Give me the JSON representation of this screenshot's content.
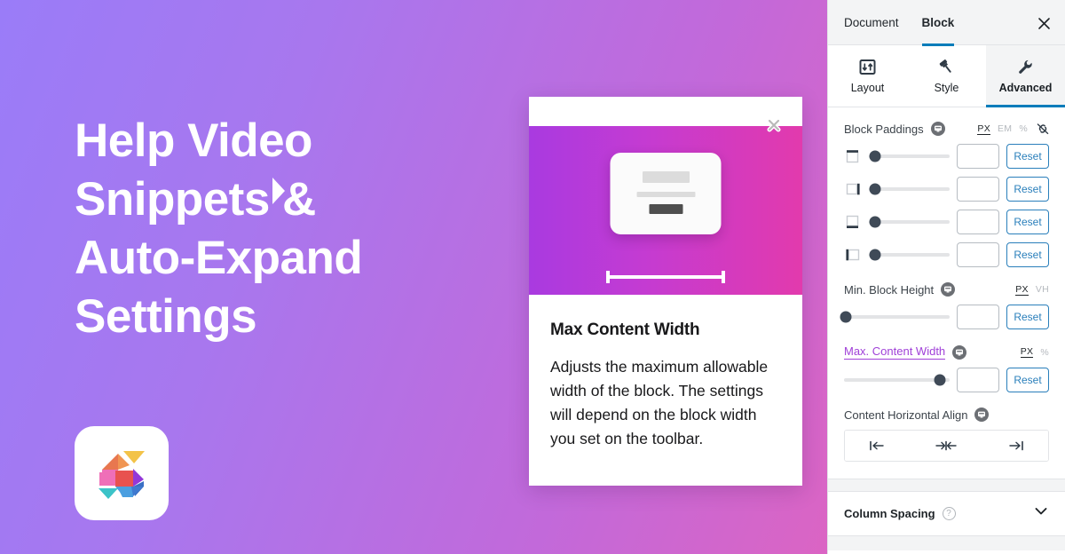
{
  "promo": {
    "title": "Help Video\nSnippets &\nAuto-Expand\nSettings",
    "logo_name": "stackable-logo"
  },
  "help_card": {
    "close_label": "✕",
    "title": "Max Content Width",
    "description": "Adjusts the maximum allowable width of the block. The settings will depend on the block width you set on the toolbar."
  },
  "inspector": {
    "tabs": [
      {
        "label": "Document",
        "active": false
      },
      {
        "label": "Block",
        "active": true
      }
    ],
    "close_label": "✕",
    "sections": [
      {
        "label": "Layout",
        "icon": "layout-icon",
        "active": false
      },
      {
        "label": "Style",
        "icon": "brush-icon",
        "active": false
      },
      {
        "label": "Advanced",
        "icon": "wrench-icon",
        "active": true
      }
    ],
    "block_paddings": {
      "label": "Block Paddings",
      "help_icon": "help-video-icon",
      "units": [
        {
          "label": "PX",
          "active": true
        },
        {
          "label": "EM",
          "active": false
        },
        {
          "label": "%",
          "active": false
        }
      ],
      "link_icon": "unlink-icon",
      "rows": [
        {
          "side": "top",
          "icon": "padding-top-icon",
          "value": "",
          "knob_pct": 8,
          "reset_label": "Reset"
        },
        {
          "side": "right",
          "icon": "padding-right-icon",
          "value": "",
          "knob_pct": 8,
          "reset_label": "Reset"
        },
        {
          "side": "bottom",
          "icon": "padding-bottom-icon",
          "value": "",
          "knob_pct": 8,
          "reset_label": "Reset"
        },
        {
          "side": "left",
          "icon": "padding-left-icon",
          "value": "",
          "knob_pct": 8,
          "reset_label": "Reset"
        }
      ]
    },
    "min_block_height": {
      "label": "Min. Block Height",
      "help_icon": "help-video-icon",
      "units": [
        {
          "label": "PX",
          "active": true
        },
        {
          "label": "VH",
          "active": false
        }
      ],
      "value": "",
      "knob_pct": 2,
      "reset_label": "Reset"
    },
    "max_content_width": {
      "label": "Max. Content Width",
      "highlighted": true,
      "highlight_color": "#a040d8",
      "help_icon": "help-video-icon",
      "units": [
        {
          "label": "PX",
          "active": true
        },
        {
          "label": "%",
          "active": false
        }
      ],
      "value": "",
      "knob_pct": 91,
      "reset_label": "Reset"
    },
    "content_horizontal_align": {
      "label": "Content Horizontal Align",
      "help_icon": "help-video-icon",
      "buttons": [
        {
          "name": "align-left-button",
          "icon": "align-left-icon"
        },
        {
          "name": "align-center-button",
          "icon": "align-center-icon"
        },
        {
          "name": "align-right-button",
          "icon": "align-right-icon"
        }
      ]
    },
    "accordion": {
      "label": "Column Spacing",
      "help_icon": "question-icon",
      "chevron_icon": "chevron-down-icon"
    }
  },
  "colors": {
    "accent_blue": "#007cba",
    "reset_blue": "#2a7fbb",
    "highlight_purple": "#a040d8",
    "bg_gradient_start": "#9a7cf8",
    "bg_gradient_end": "#ea5fb6"
  }
}
